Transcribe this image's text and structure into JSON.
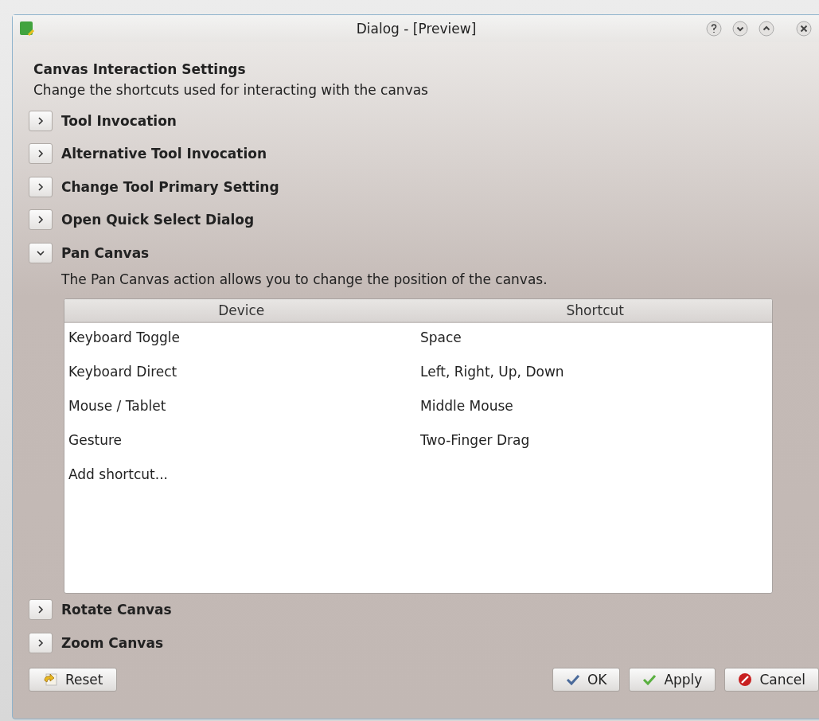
{
  "window": {
    "title": "Dialog - [Preview]"
  },
  "heading": "Canvas Interaction Settings",
  "subheading": "Change the shortcuts used for interacting with the canvas",
  "sections": [
    {
      "label": "Tool Invocation",
      "expanded": false
    },
    {
      "label": "Alternative Tool Invocation",
      "expanded": false
    },
    {
      "label": "Change Tool Primary Setting",
      "expanded": false
    },
    {
      "label": "Open Quick Select Dialog",
      "expanded": false
    },
    {
      "label": "Pan Canvas",
      "expanded": true,
      "description": "The Pan Canvas action allows you to change the position of the canvas.",
      "table": {
        "columns": [
          "Device",
          "Shortcut"
        ],
        "rows": [
          [
            "Keyboard Toggle",
            "Space"
          ],
          [
            "Keyboard Direct",
            "Left, Right, Up, Down"
          ],
          [
            "Mouse / Tablet",
            "Middle Mouse"
          ],
          [
            "Gesture",
            "Two-Finger Drag"
          ],
          [
            "Add shortcut...",
            ""
          ]
        ]
      }
    },
    {
      "label": "Rotate Canvas",
      "expanded": false
    },
    {
      "label": "Zoom Canvas",
      "expanded": false
    }
  ],
  "buttons": {
    "left": [
      {
        "label": "Reset",
        "kind": "reset"
      }
    ],
    "right": [
      {
        "label": "OK",
        "kind": "ok"
      },
      {
        "label": "Apply",
        "kind": "apply"
      },
      {
        "label": "Cancel",
        "kind": "cancel"
      }
    ]
  }
}
